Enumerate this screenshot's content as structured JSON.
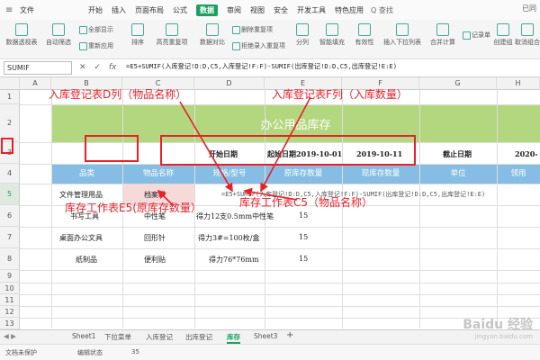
{
  "menu": {
    "file": "文件",
    "items": [
      "开始",
      "插入",
      "页面布局",
      "公式",
      "数据",
      "审阅",
      "视图",
      "安全",
      "开发工具",
      "特色应用"
    ],
    "active": "数据",
    "search": "Q 查找",
    "right": "已同"
  },
  "toolbar": {
    "labels": [
      "数据透视表",
      "自动筛选",
      "全部显示",
      "重新应用",
      "排序",
      "高亮重复项",
      "数据对比",
      "删除重复项",
      "拒绝录入重复项",
      "分列",
      "智能填充",
      "有效性",
      "插入下拉列表",
      "合并计算",
      "记录单",
      "创建组",
      "取消组合"
    ]
  },
  "formula_bar": {
    "name_box": "SUMIF",
    "fx": "fx",
    "formula": "=E5+SUMIF(入库登记!D:D,C5,入库登记!F:F)-SUMIF(出库登记!D:D,C5,出库登记!E:E)"
  },
  "columns": [
    "A",
    "B",
    "C",
    "D",
    "E",
    "F",
    "G",
    "H"
  ],
  "rows": [
    "1",
    "2",
    "3",
    "4",
    "5",
    "6",
    "7",
    "8",
    "9",
    "10",
    "11",
    "12",
    "13"
  ],
  "sheet": {
    "title": "办公用品库存",
    "start_date_label": "开始日期",
    "start_date": "起始日期2019-10-01",
    "end_date": "2019-10-11",
    "cutoff_label": "截止日期",
    "cutoff_date": "2020-",
    "headers": [
      "品类",
      "物品名称",
      "规格/型号",
      "原库存数量",
      "现库存数量",
      "单位",
      "领用"
    ],
    "data": [
      {
        "category": "文件管理用品",
        "name": "档案袋",
        "spec": "",
        "qty": ""
      },
      {
        "category": "书写工具",
        "name": "中性笔",
        "spec": "得力12支0.5mm中性笔",
        "qty": "15"
      },
      {
        "category": "桌面办公文具",
        "name": "回形针",
        "spec": "得力3#=100枚/盒",
        "qty": "15"
      },
      {
        "category": "纸制品",
        "name": "便利贴",
        "spec": "得力76*76mm",
        "qty": "15"
      }
    ],
    "inline_formula": "=E5+SUMIF(入库登记!D:D,C5,入库登记!F:F)-SUMIF(出库登记!D:D,C5,出库登记!E:E)"
  },
  "annotations": {
    "d_col": "入库登记表D列（物品名称）",
    "f_col": "入库登记表F列（入库数量）",
    "e5": "库存工作表E5(原库存数量）",
    "c5": "库存工作表C5（物品名称）"
  },
  "tabs": [
    "Sheet1",
    "下拉菜单",
    "入库登记",
    "出库登记",
    "库存",
    "Sheet3"
  ],
  "active_tab": "库存",
  "status": {
    "protect": "文档未保护",
    "mode": "编辑状态",
    "count": "35"
  },
  "watermark": {
    "brand": "Baidu 经验",
    "url": "jingyan.baidu.com"
  },
  "colors": {
    "accent": "#1aa15f",
    "title_band": "#b3d77f",
    "header_band": "#86bde4",
    "annotation": "#e8202a"
  }
}
